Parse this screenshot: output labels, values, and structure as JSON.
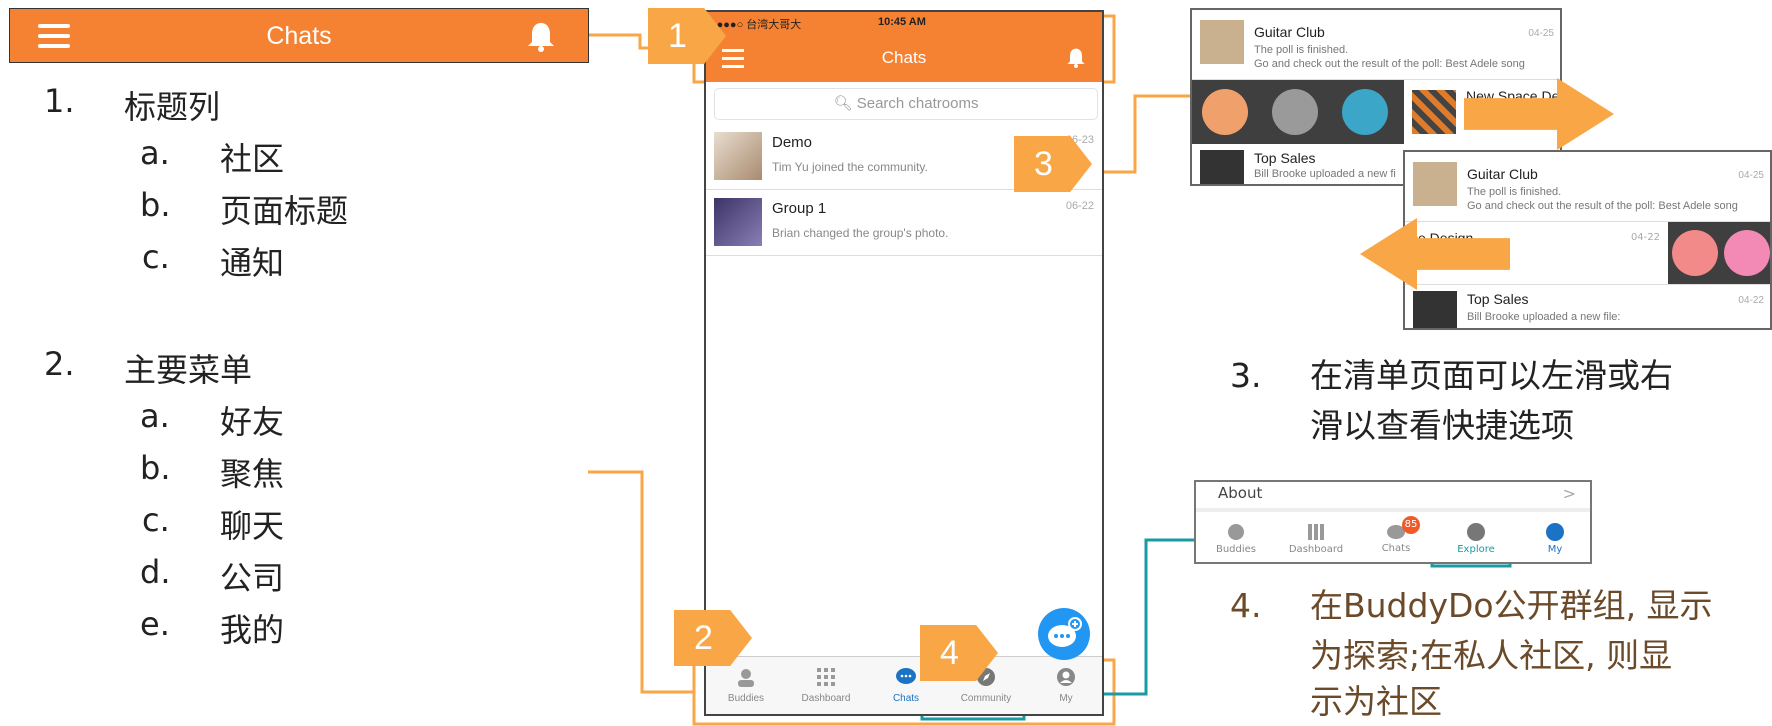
{
  "header": {
    "title": "Chats"
  },
  "outline": {
    "item1": {
      "num": "1.",
      "label": "标题列",
      "subs": [
        {
          "l": "a.",
          "t": "社区"
        },
        {
          "l": "b.",
          "t": "页面标题"
        },
        {
          "l": "c.",
          "t": "通知"
        }
      ]
    },
    "item2": {
      "num": "2.",
      "label": "主要菜单",
      "subs": [
        {
          "l": "a.",
          "t": "好友"
        },
        {
          "l": "b.",
          "t": "聚焦"
        },
        {
          "l": "c.",
          "t": "聊天"
        },
        {
          "l": "d.",
          "t": "公司"
        },
        {
          "l": "e.",
          "t": "我的"
        }
      ]
    }
  },
  "badges": {
    "b1": "1",
    "b2": "2",
    "b3": "3",
    "b4": "4"
  },
  "phone": {
    "status_carrier": "●●●●○ 台湾大哥大 ",
    "status_time": "10:45 AM",
    "nav_title": "Chats",
    "search_placeholder": "Search chatrooms",
    "chats": [
      {
        "name": "Demo",
        "sub": "Tim Yu joined the community.",
        "date": "06-23"
      },
      {
        "name": "Group 1",
        "sub": "Brian changed the group's photo.",
        "date": "06-22"
      }
    ],
    "tabs": [
      {
        "label": "Buddies"
      },
      {
        "label": "Dashboard"
      },
      {
        "label": "Chats"
      },
      {
        "label": "Community"
      },
      {
        "label": "My"
      }
    ]
  },
  "shot_a": {
    "row1": {
      "title": "Guitar Club",
      "sub1": "The poll is finished.",
      "sub2": "Go and check out the result of the poll: Best Adele song",
      "date": "04-25"
    },
    "row2": {
      "title": "New Space De"
    },
    "row3": {
      "title": "Top Sales",
      "sub1": "Bill Brooke uploaded a new fi"
    }
  },
  "shot_b": {
    "row1": {
      "title": "Guitar Club",
      "sub1": "The poll is finished.",
      "sub2": "Go and check out the result of the poll: Best Adele song",
      "date": "04-25"
    },
    "row2": {
      "title": "ce Design",
      "date": "04-22"
    },
    "row3": {
      "title": "Top Sales",
      "sub1": "Bill Brooke uploaded a new file:",
      "date": "04-22"
    }
  },
  "note3": {
    "num": "3.",
    "line1": "在清单页面可以左滑或右",
    "line2": "滑以查看快捷选项"
  },
  "shot_c": {
    "about": "About",
    "badge": "85",
    "tabs": [
      {
        "label": "Buddies"
      },
      {
        "label": "Dashboard"
      },
      {
        "label": "Chats"
      },
      {
        "label": "Explore"
      },
      {
        "label": "My"
      }
    ]
  },
  "note4": {
    "num": "4.",
    "line1": "在BuddyDo公开群组, 显示",
    "line2": "为探索;在私人社区, 则显",
    "line3": "示为社区"
  },
  "colors": {
    "orange": "#f58232",
    "badge": "#f9a646",
    "teal": "#1a9ba3",
    "blue": "#1a73c4"
  }
}
